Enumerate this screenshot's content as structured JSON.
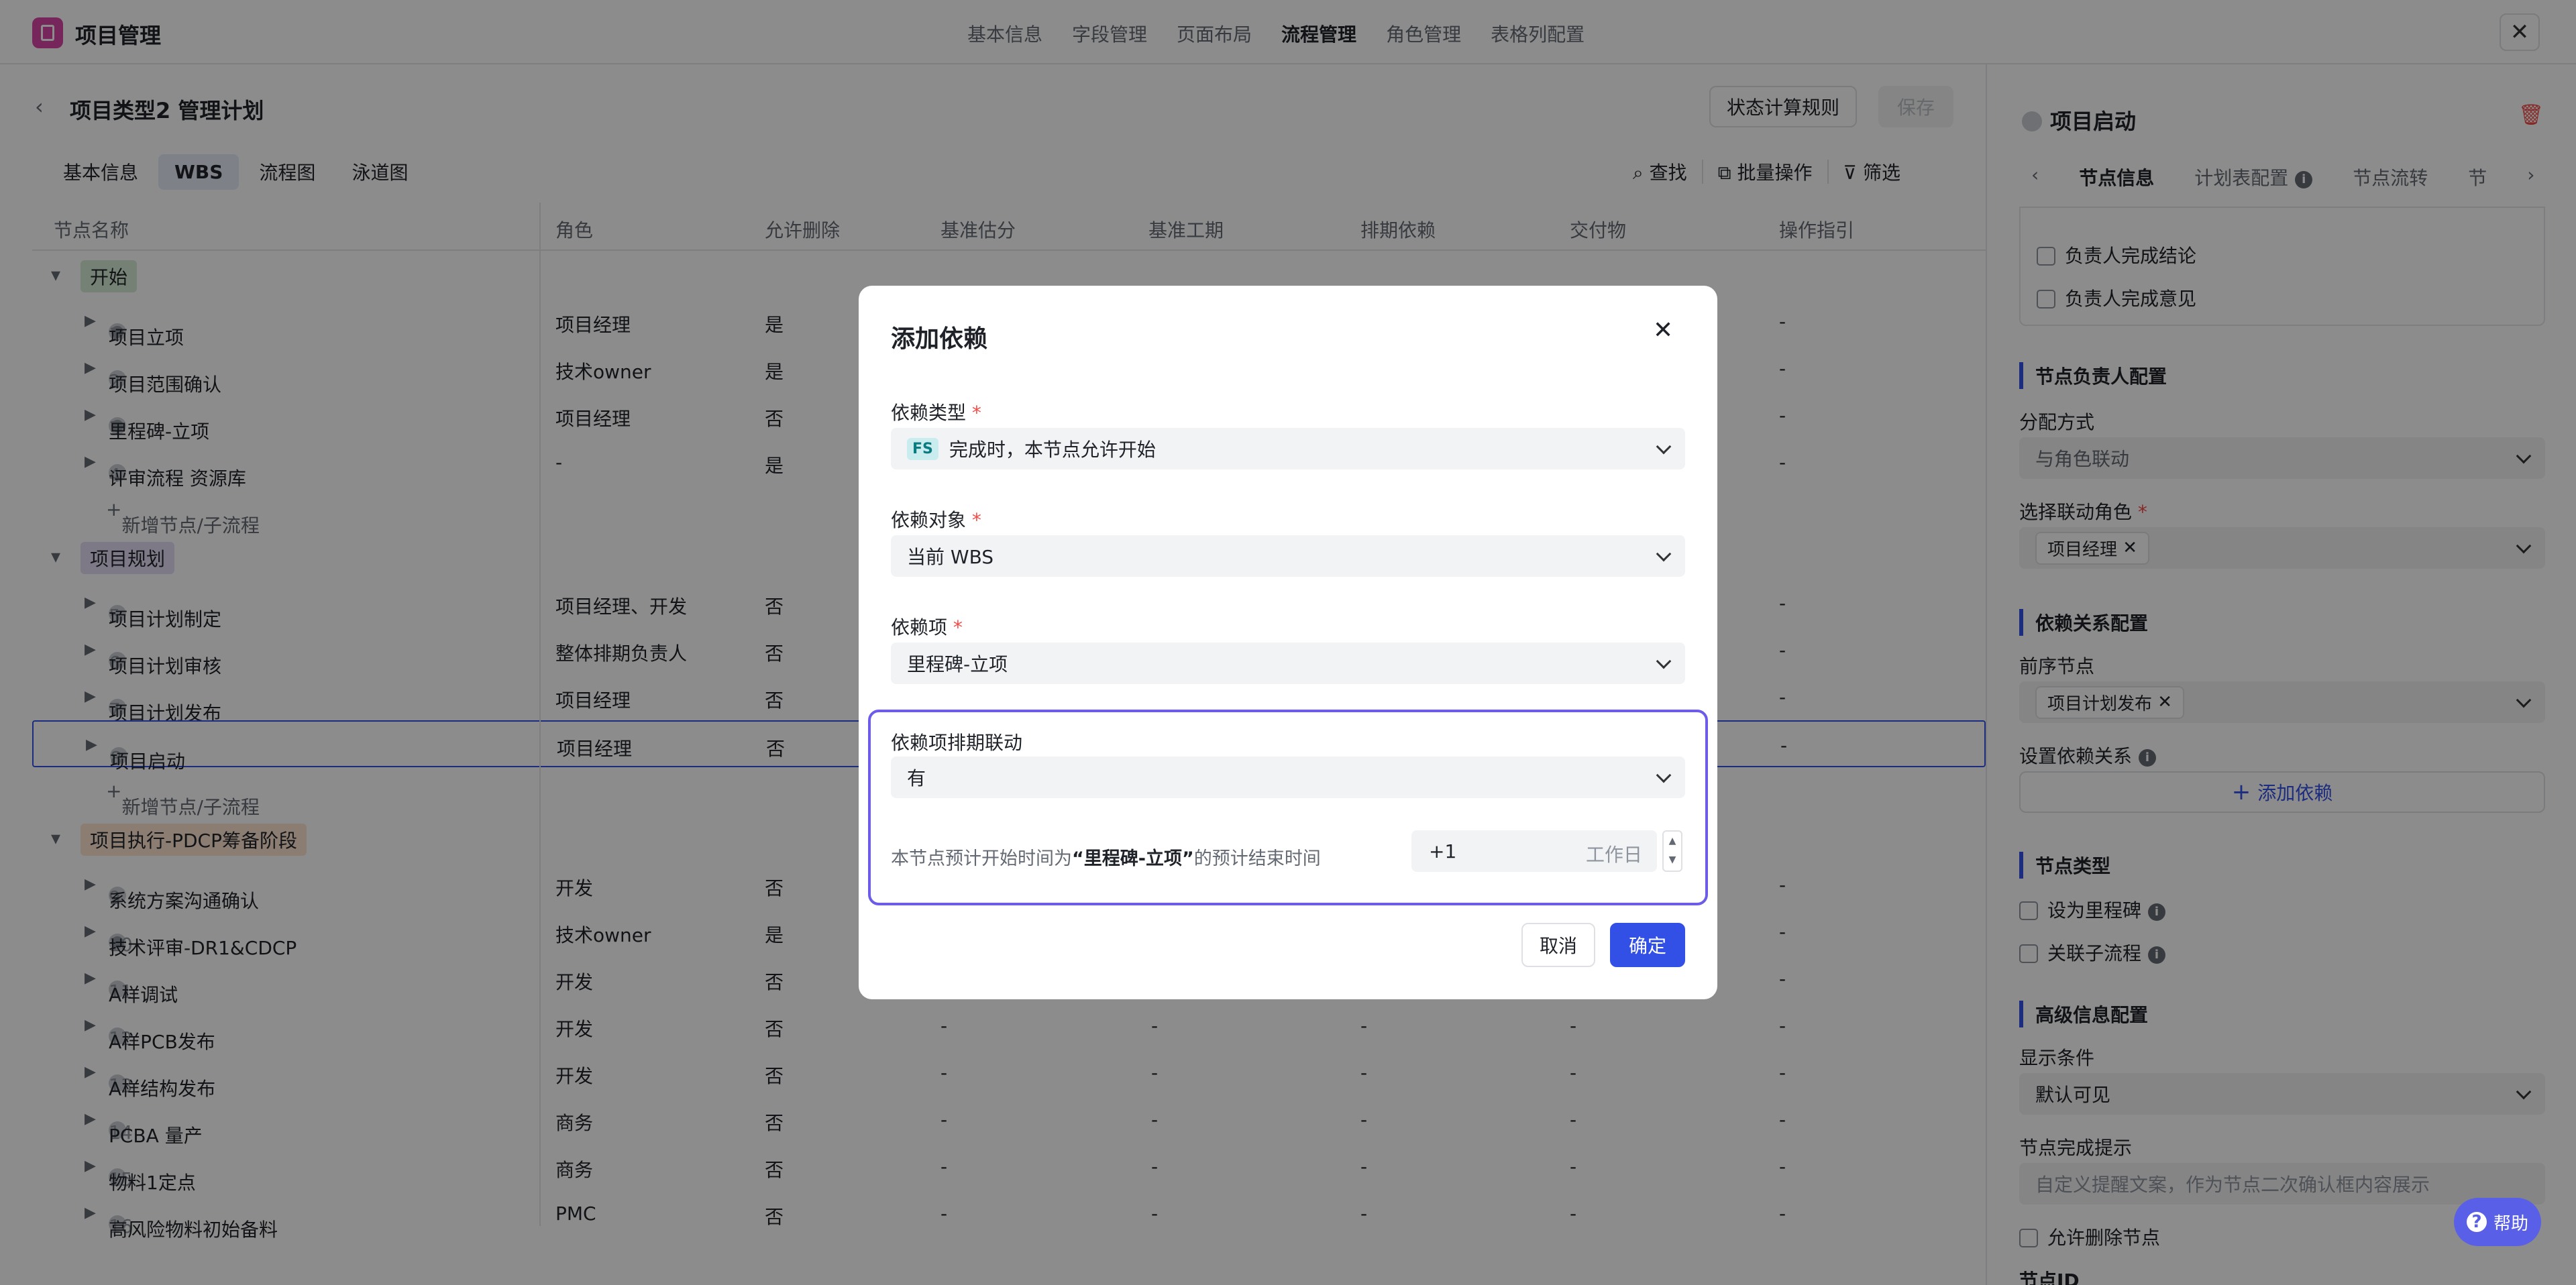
{
  "app": {
    "title": "项目管理",
    "nav": [
      "基本信息",
      "字段管理",
      "页面布局",
      "流程管理",
      "角色管理",
      "表格列配置"
    ],
    "nav_active": 3,
    "close": "✕"
  },
  "page": {
    "back": "‹",
    "title": "项目类型2 管理计划",
    "btn_state_rule": "状态计算规则",
    "btn_save": "保存"
  },
  "subtabs": [
    "基本信息",
    "WBS",
    "流程图",
    "泳道图"
  ],
  "subtab_active": 1,
  "tools": {
    "find": "查找",
    "batch": "批量操作",
    "filter": "筛选"
  },
  "table": {
    "headers": [
      "节点名称",
      "角色",
      "允许删除",
      "基准估分",
      "基准工期",
      "排期依赖",
      "交付物",
      "操作指引"
    ],
    "groups": [
      {
        "name": "开始",
        "color": "#d5ecd4"
      },
      {
        "name": "项目规划",
        "color": "#e6ddf5"
      },
      {
        "name": "项目执行-PDCP筹备阶段",
        "color": "#fde3cf"
      }
    ],
    "add_node": "新增节点/子流程",
    "rows": [
      {
        "num": "1",
        "name": "项目立项",
        "role": "项目经理",
        "del": "是",
        "c1": "",
        "c2": "",
        "c3": "",
        "c4": "",
        "guide": "-",
        "dark": true
      },
      {
        "num": "2",
        "name": "项目范围确认",
        "role": "技术owner",
        "del": "是",
        "c1": "",
        "c2": "",
        "c3": "",
        "c4": "",
        "guide": "-",
        "dark": false
      },
      {
        "num": "3",
        "name": "里程碑-立项",
        "role": "项目经理",
        "del": "否",
        "c1": "",
        "c2": "",
        "c3": "",
        "c4": "",
        "guide": "-",
        "dark": true
      },
      {
        "num": "4",
        "name": "评审流程 资源库",
        "role": "-",
        "del": "是",
        "c1": "",
        "c2": "",
        "c3": "",
        "c4": "",
        "guide": "-",
        "dark": false
      },
      {
        "num": "5",
        "name": "项目计划制定",
        "role": "项目经理、开发",
        "del": "否",
        "c1": "",
        "c2": "",
        "c3": "",
        "c4": "",
        "guide": "-",
        "dark": false
      },
      {
        "num": "6",
        "name": "项目计划审核",
        "role": "整体排期负责人",
        "del": "否",
        "c1": "",
        "c2": "",
        "c3": "",
        "c4": "",
        "guide": "-",
        "dark": false
      },
      {
        "num": "7",
        "name": "项目计划发布",
        "role": "项目经理",
        "del": "否",
        "c1": "",
        "c2": "",
        "c3": "",
        "c4": "",
        "guide": "-",
        "dark": false
      },
      {
        "num": "8",
        "name": "项目启动",
        "role": "项目经理",
        "del": "否",
        "c1": "",
        "c2": "",
        "c3": "",
        "c4": "",
        "guide": "-",
        "dark": false
      },
      {
        "num": "9",
        "name": "系统方案沟通确认",
        "role": "开发",
        "del": "否",
        "c1": "",
        "c2": "",
        "c3": "",
        "c4": "",
        "guide": "-",
        "dark": false
      },
      {
        "num": "10",
        "name": "技术评审-DR1&CDCP",
        "role": "技术owner",
        "del": "是",
        "c1": "",
        "c2": "",
        "c3": "",
        "c4": "",
        "guide": "-",
        "dark": true
      },
      {
        "num": "11",
        "name": "A样调试",
        "role": "开发",
        "del": "否",
        "c1": "",
        "c2": "",
        "c3": "",
        "c4": "",
        "guide": "-",
        "dark": false
      },
      {
        "num": "12",
        "name": "A样PCB发布",
        "role": "开发",
        "del": "否",
        "c1": "-",
        "c2": "-",
        "c3": "-",
        "c4": "-",
        "guide": "-",
        "dark": false
      },
      {
        "num": "13",
        "name": "A样结构发布",
        "role": "开发",
        "del": "否",
        "c1": "-",
        "c2": "-",
        "c3": "-",
        "c4": "-",
        "guide": "-",
        "dark": false
      },
      {
        "num": "14",
        "name": "PCBA 量产",
        "role": "商务",
        "del": "否",
        "c1": "-",
        "c2": "-",
        "c3": "-",
        "c4": "-",
        "guide": "-",
        "dark": false
      },
      {
        "num": "15",
        "name": "物料1定点",
        "role": "商务",
        "del": "否",
        "c1": "-",
        "c2": "-",
        "c3": "-",
        "c4": "-",
        "guide": "-",
        "dark": false
      },
      {
        "num": "16",
        "name": "高风险物料初始备料",
        "role": "PMC",
        "del": "否",
        "c1": "-",
        "c2": "-",
        "c3": "-",
        "c4": "-",
        "guide": "-",
        "dark": false
      }
    ]
  },
  "panel": {
    "title": "项目启动",
    "tabs": [
      "节点信息",
      "计划表配置",
      "节点流转",
      "节"
    ],
    "checks_top": [
      "负责人完成结论",
      "负责人完成意见"
    ],
    "owner_section": "节点负责人配置",
    "assign_label": "分配方式",
    "assign_value": "与角色联动",
    "role_label": "选择联动角色",
    "role_tag": "项目经理",
    "dep_section": "依赖关系配置",
    "pre_label": "前序节点",
    "pre_tag": "项目计划发布",
    "set_dep_label": "设置依赖关系",
    "add_dep": "添加依赖",
    "type_section": "节点类型",
    "milestone": "设为里程碑",
    "subflow": "关联子流程",
    "adv_section": "高级信息配置",
    "show_label": "显示条件",
    "show_value": "默认可见",
    "tip_label": "节点完成提示",
    "tip_placeholder": "自定义提醒文案，作为节点二次确认框内容展示",
    "allow_delete": "允许删除节点",
    "node_id": "节点ID",
    "help": "帮助"
  },
  "modal": {
    "title": "添加依赖",
    "type_label": "依赖类型",
    "type_badge": "FS",
    "type_value": "完成时，本节点允许开始",
    "target_label": "依赖对象",
    "target_value": "当前 WBS",
    "item_label": "依赖项",
    "item_value": "里程碑-立项",
    "link_label": "依赖项排期联动",
    "link_value": "有",
    "desc_pre": "本节点预计开始时间为",
    "desc_bold": "“里程碑-立项”",
    "desc_post": "的预计结束时间",
    "offset_value": "+1",
    "offset_unit": "工作日",
    "cancel": "取消",
    "ok": "确定"
  },
  "colors": {
    "primary": "#3350e6",
    "danger": "#f54a45",
    "logo": "#d946a8"
  }
}
